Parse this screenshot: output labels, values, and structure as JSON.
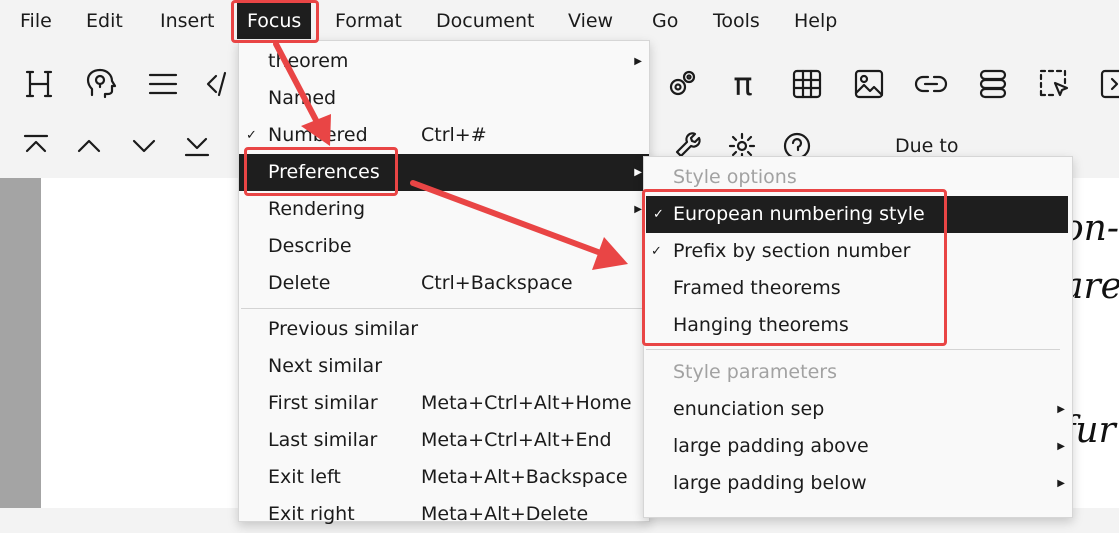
{
  "menubar": {
    "items": [
      "File",
      "Edit",
      "Insert",
      "Focus",
      "Format",
      "Document",
      "View",
      "Go",
      "Tools",
      "Help"
    ],
    "active": "Focus"
  },
  "toolbar": {
    "row1_icons": [
      "heading-icon",
      "lightbulb-head-icon",
      "list-icon",
      "code-icon",
      "gears-icon",
      "pi-icon",
      "table-icon",
      "image-icon",
      "link-icon",
      "database-icon",
      "select-region-icon",
      "expand-icon"
    ],
    "row2_icons": [
      "go-top-icon",
      "go-up-icon",
      "go-down-icon",
      "go-bottom-icon",
      "wrench-icon",
      "gear-icon",
      "help-icon"
    ],
    "pi_glyph": "π",
    "due_text": "Due to"
  },
  "document": {
    "fragment1": "on-",
    "fragment2": "are",
    "fragment3": "fur"
  },
  "focus_menu": {
    "items": [
      {
        "label": "theorem",
        "shortcut": "",
        "checked": false,
        "submenu": true
      },
      {
        "label": "Named",
        "shortcut": "",
        "checked": false,
        "submenu": false
      },
      {
        "label": "Numbered",
        "shortcut": "Ctrl+#",
        "checked": true,
        "submenu": false
      },
      {
        "label": "Preferences",
        "shortcut": "",
        "checked": false,
        "submenu": true,
        "highlighted": true
      },
      {
        "label": "Rendering",
        "shortcut": "",
        "checked": false,
        "submenu": true
      },
      {
        "label": "Describe",
        "shortcut": "",
        "checked": false,
        "submenu": false
      },
      {
        "label": "Delete",
        "shortcut": "Ctrl+Backspace",
        "checked": false,
        "submenu": false
      },
      {
        "label": "Previous similar",
        "shortcut": "",
        "checked": false,
        "submenu": false
      },
      {
        "label": "Next similar",
        "shortcut": "",
        "checked": false,
        "submenu": false
      },
      {
        "label": "First similar",
        "shortcut": "Meta+Ctrl+Alt+Home",
        "checked": false,
        "submenu": false
      },
      {
        "label": "Last similar",
        "shortcut": "Meta+Ctrl+Alt+End",
        "checked": false,
        "submenu": false
      },
      {
        "label": "Exit left",
        "shortcut": "Meta+Alt+Backspace",
        "checked": false,
        "submenu": false
      },
      {
        "label": "Exit right",
        "shortcut": "Meta+Alt+Delete",
        "checked": false,
        "submenu": false
      }
    ]
  },
  "preferences_menu": {
    "header1": "Style options",
    "options": [
      {
        "label": "European numbering style",
        "checked": true,
        "highlighted": true
      },
      {
        "label": "Prefix by section number",
        "checked": true
      },
      {
        "label": "Framed theorems",
        "checked": false
      },
      {
        "label": "Hanging theorems",
        "checked": false
      }
    ],
    "header2": "Style parameters",
    "params": [
      {
        "label": "enunciation sep",
        "submenu": true
      },
      {
        "label": "large padding above",
        "submenu": true
      },
      {
        "label": "large padding below",
        "submenu": true
      }
    ]
  },
  "glyphs": {
    "check": "✓",
    "arrow": "▶"
  },
  "annotation_color": "#e94545"
}
